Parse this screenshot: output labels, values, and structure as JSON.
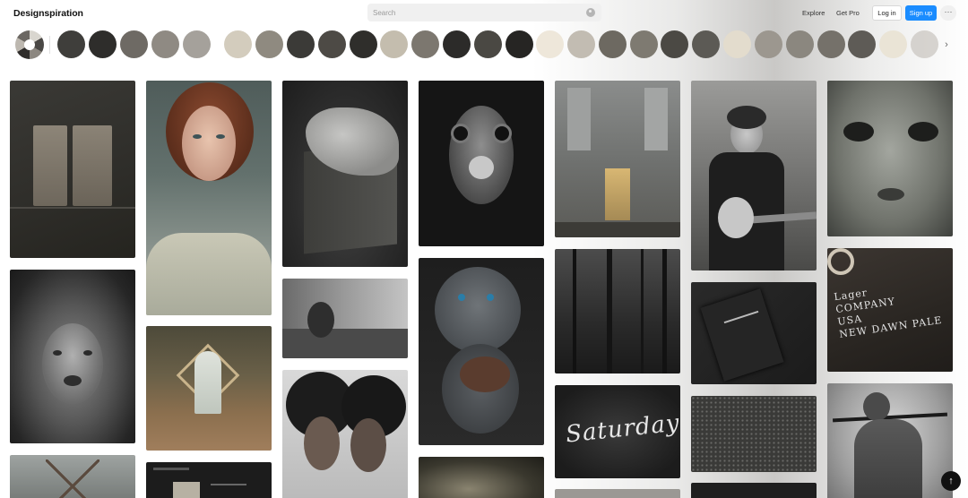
{
  "header": {
    "logo": "Designspiration",
    "search_placeholder": "Search",
    "nav": {
      "explore": "Explore",
      "get_pro": "Get Pro"
    },
    "login_label": "Log in",
    "signup_label": "Sign up",
    "more_label": "···"
  },
  "colors": {
    "accent": "#1a8cff",
    "swatches": [
      "#3f3e3b",
      "#2e2d2b",
      "#6e6a64",
      "#8f8a83",
      "#a5a19b",
      "#d3ccbd",
      "#8f8a80",
      "#3b3a37",
      "#4d4a45",
      "#2f2e2b",
      "#c4bdae",
      "#7c776f",
      "#2c2b29",
      "#4a4843",
      "#262523",
      "#eee7da",
      "#c2bcb2",
      "#6d6961",
      "#7e7a71",
      "#4b4944",
      "#5c5a55",
      "#e3dccd",
      "#9c978f",
      "#8b877f",
      "#75716a",
      "#5e5b56",
      "#eae4d6",
      "#c7c3bd"
    ]
  },
  "strip_next_label": "›",
  "scroll_top_label": "↑",
  "pins": [
    {
      "subject": "woven-textile"
    },
    {
      "subject": "portrait-woman"
    },
    {
      "subject": "paper-sculpture"
    },
    {
      "subject": "hairless-dog"
    },
    {
      "subject": "cathedral-interior"
    },
    {
      "subject": "musician-guitar"
    },
    {
      "subject": "face-closeup"
    },
    {
      "subject": "lion"
    },
    {
      "subject": "woman-with-ropes"
    },
    {
      "subject": "puppy"
    },
    {
      "subject": "misty-forest"
    },
    {
      "subject": "dark-stationery"
    },
    {
      "subject": "lager-label-wood",
      "text_lines": [
        "Lager",
        "COMPANY",
        "USA",
        "NEW DAWN PALE"
      ]
    },
    {
      "subject": "ghost-frame-forest"
    },
    {
      "subject": "two-women-portrait"
    },
    {
      "subject": "saturday-lettering",
      "text": "Saturday"
    },
    {
      "subject": "textured-fabric"
    },
    {
      "subject": "person-with-sword"
    },
    {
      "subject": "a-frame-cabin"
    },
    {
      "subject": "website-screen"
    },
    {
      "subject": "floral-dark"
    },
    {
      "subject": "partial-bottom-1"
    },
    {
      "subject": "partial-bottom-2"
    }
  ]
}
